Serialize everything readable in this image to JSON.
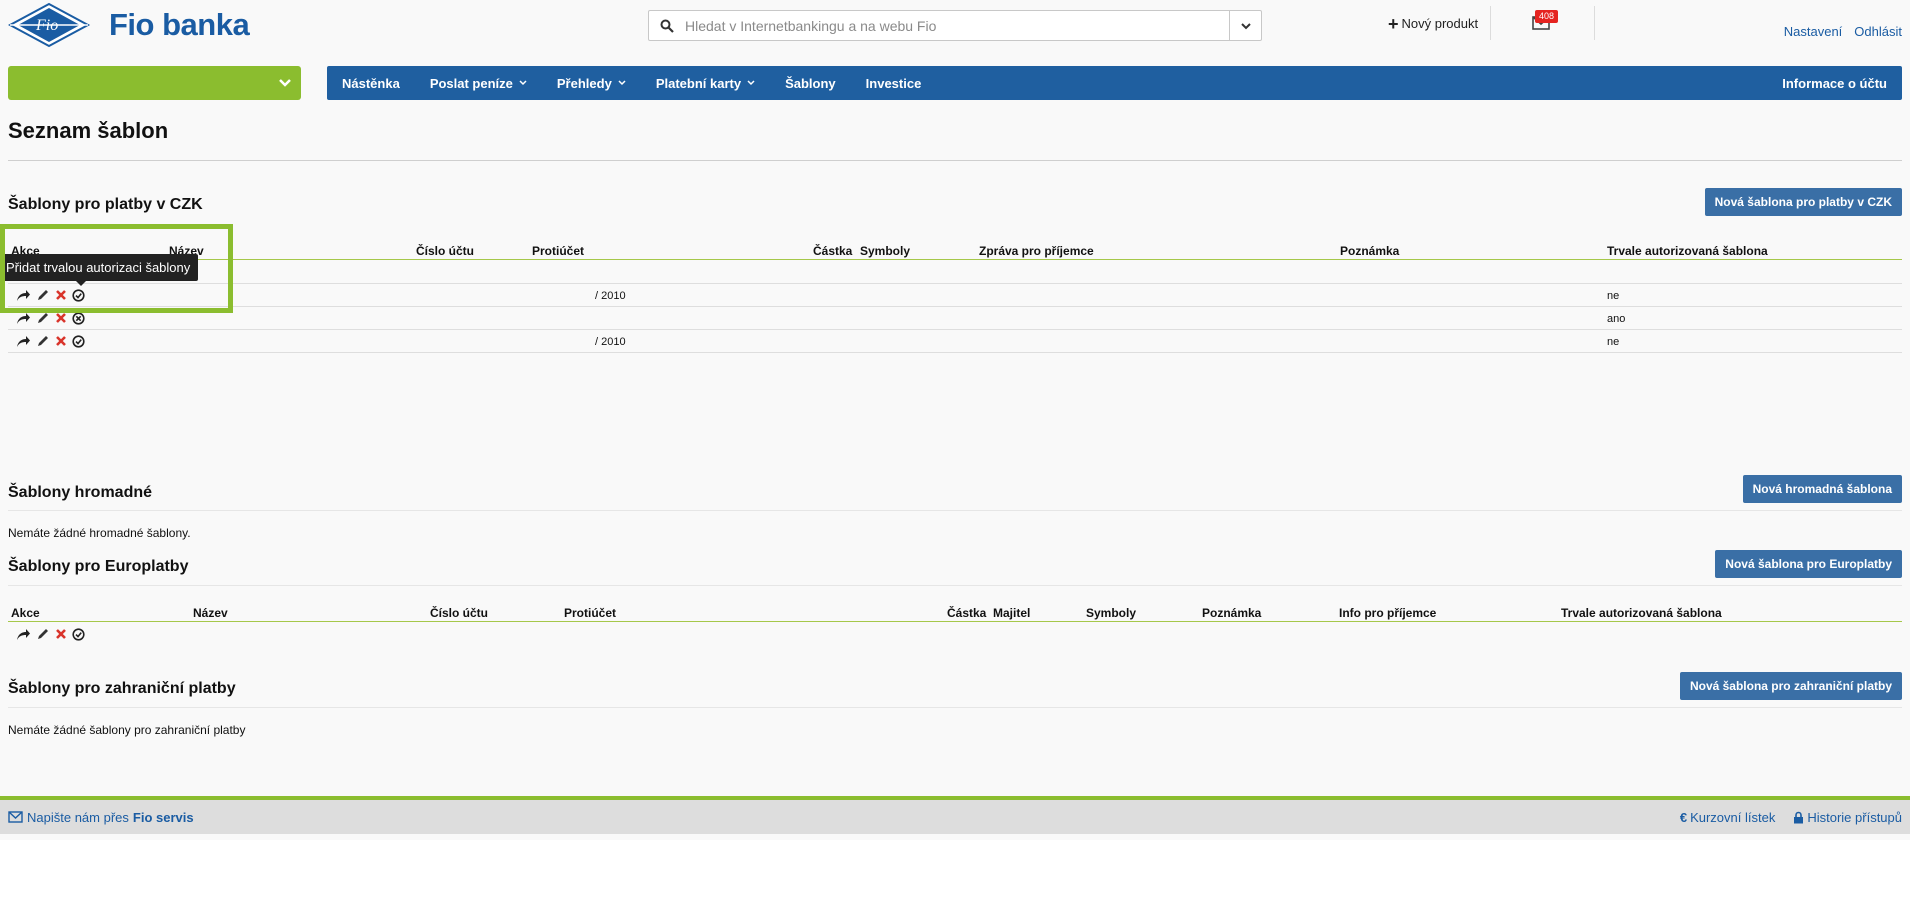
{
  "header": {
    "logo_mark_text": "Fio",
    "logo_text": "Fio banka",
    "search_placeholder": "Hledat v Internetbankingu a na webu Fio",
    "new_product": "Nový produkt",
    "mail_badge": "408",
    "settings": "Nastavení",
    "logout": "Odhlásit"
  },
  "nav": {
    "items": [
      {
        "label": "Nástěnka",
        "has_dropdown": false
      },
      {
        "label": "Poslat peníze",
        "has_dropdown": true
      },
      {
        "label": "Přehledy",
        "has_dropdown": true
      },
      {
        "label": "Platební karty",
        "has_dropdown": true
      },
      {
        "label": "Šablony",
        "has_dropdown": false
      },
      {
        "label": "Investice",
        "has_dropdown": false
      }
    ],
    "account_info": "Informace o účtu"
  },
  "page_title": "Seznam šablon",
  "czk": {
    "title": "Šablony pro platby v CZK",
    "new_button": "Nová šablona pro platby v CZK",
    "columns": {
      "akce": "Akce",
      "nazev": "Název",
      "cislo_uctu": "Číslo účtu",
      "protiucet": "Protiúčet",
      "castka": "Částka",
      "symboly": "Symboly",
      "zprava": "Zpráva pro příjemce",
      "poznamka": "Poznámka",
      "autorizovana": "Trvale autorizovaná šablona"
    },
    "rows": [
      {
        "protiucet": "",
        "autorizovana": ""
      },
      {
        "protiucet": "/ 2010",
        "autorizovana": "ne"
      },
      {
        "protiucet": "",
        "autorizovana": "ano"
      },
      {
        "protiucet": "/ 2010",
        "autorizovana": "ne"
      }
    ],
    "tooltip": "Přidat trvalou autorizaci šablony"
  },
  "hromadne": {
    "title": "Šablony hromadné",
    "new_button": "Nová hromadná šablona",
    "empty": "Nemáte žádné hromadné šablony."
  },
  "euro": {
    "title": "Šablony pro Europlatby",
    "new_button": "Nová šablona pro Europlatby",
    "columns": {
      "akce": "Akce",
      "nazev": "Název",
      "cislo_uctu": "Číslo účtu",
      "protiucet": "Protiúčet",
      "castka": "Částka",
      "majitel": "Majitel",
      "symboly": "Symboly",
      "poznamka": "Poznámka",
      "info": "Info pro příjemce",
      "autorizovana": "Trvale autorizovaná šablona"
    }
  },
  "zahranicni": {
    "title": "Šablony pro zahraniční platby",
    "new_button": "Nová šablona pro zahraniční platby",
    "empty": "Nemáte žádné šablony pro zahraniční platby"
  },
  "footer": {
    "write_prefix": "Napište nám přes",
    "write_link": "Fio servis",
    "rates": "Kurzovní lístek",
    "access_history": "Historie přístupů"
  },
  "colors": {
    "brand_blue": "#1f5fa0",
    "brand_green": "#8bbd2f",
    "button_blue": "#3a6fa6",
    "delete_red": "#d9342b"
  }
}
